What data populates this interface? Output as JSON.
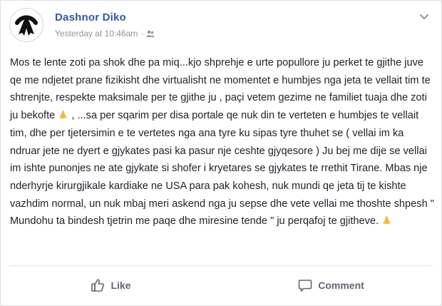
{
  "post": {
    "author": "Dashnor Diko",
    "timestamp": "Yesterday at 10:46am",
    "separator": "·",
    "audience_icon": "friends-icon",
    "menu_icon": "chevron-down-icon",
    "text_parts": [
      "Mos te lente zoti pa shok dhe pa miq...kjo shprehje e urte popullore ju perket te gjithe juve qe me ndjetet prane fizikisht dhe virtualisht ne momentet e humbjes nga jeta te vellait tim te shtrenjte, respekte maksimale per te gjithe ju , paçi vetem gezime ne familiet tuaja dhe zoti ju bekofte",
      " , ...sa per sqarim per disa portale qe nuk din te verteten e humbjes te vellait tim, dhe per tjetersimin e te vertetes nga ana tyre ku sipas tyre thuhet se ( vellai im ka ndruar jete ne dyert e gjykates pasi ka pasur nje ceshte gjyqesore ) Ju bej me dije se vellai im ishte punonjes ne ate gjykate si shofer i kryetares se gjykates te rrethit Tirane. Mbas nje nderhyrje kirurgjikale kardiake ne USA para pak kohesh, nuk mundi qe jeta tij te kishte vazhdim normal, un nuk mbaj meri askend nga ju sepse dhe vete vellai me thoshte shpesh \" Mundohu ta bindesh tjetrin me paqe dhe miresine tende \" ju perqafoj te gjitheve."
    ],
    "emoji_icon": "praying-hands-icon",
    "emoji_color": "#f5c33b"
  },
  "actions": {
    "like_label": "Like",
    "comment_label": "Comment",
    "like_icon": "thumbs-up-icon",
    "comment_icon": "comment-bubble-icon"
  },
  "colors": {
    "author": "#365899",
    "meta": "#90949c",
    "text": "#1d2129",
    "action": "#606770"
  }
}
